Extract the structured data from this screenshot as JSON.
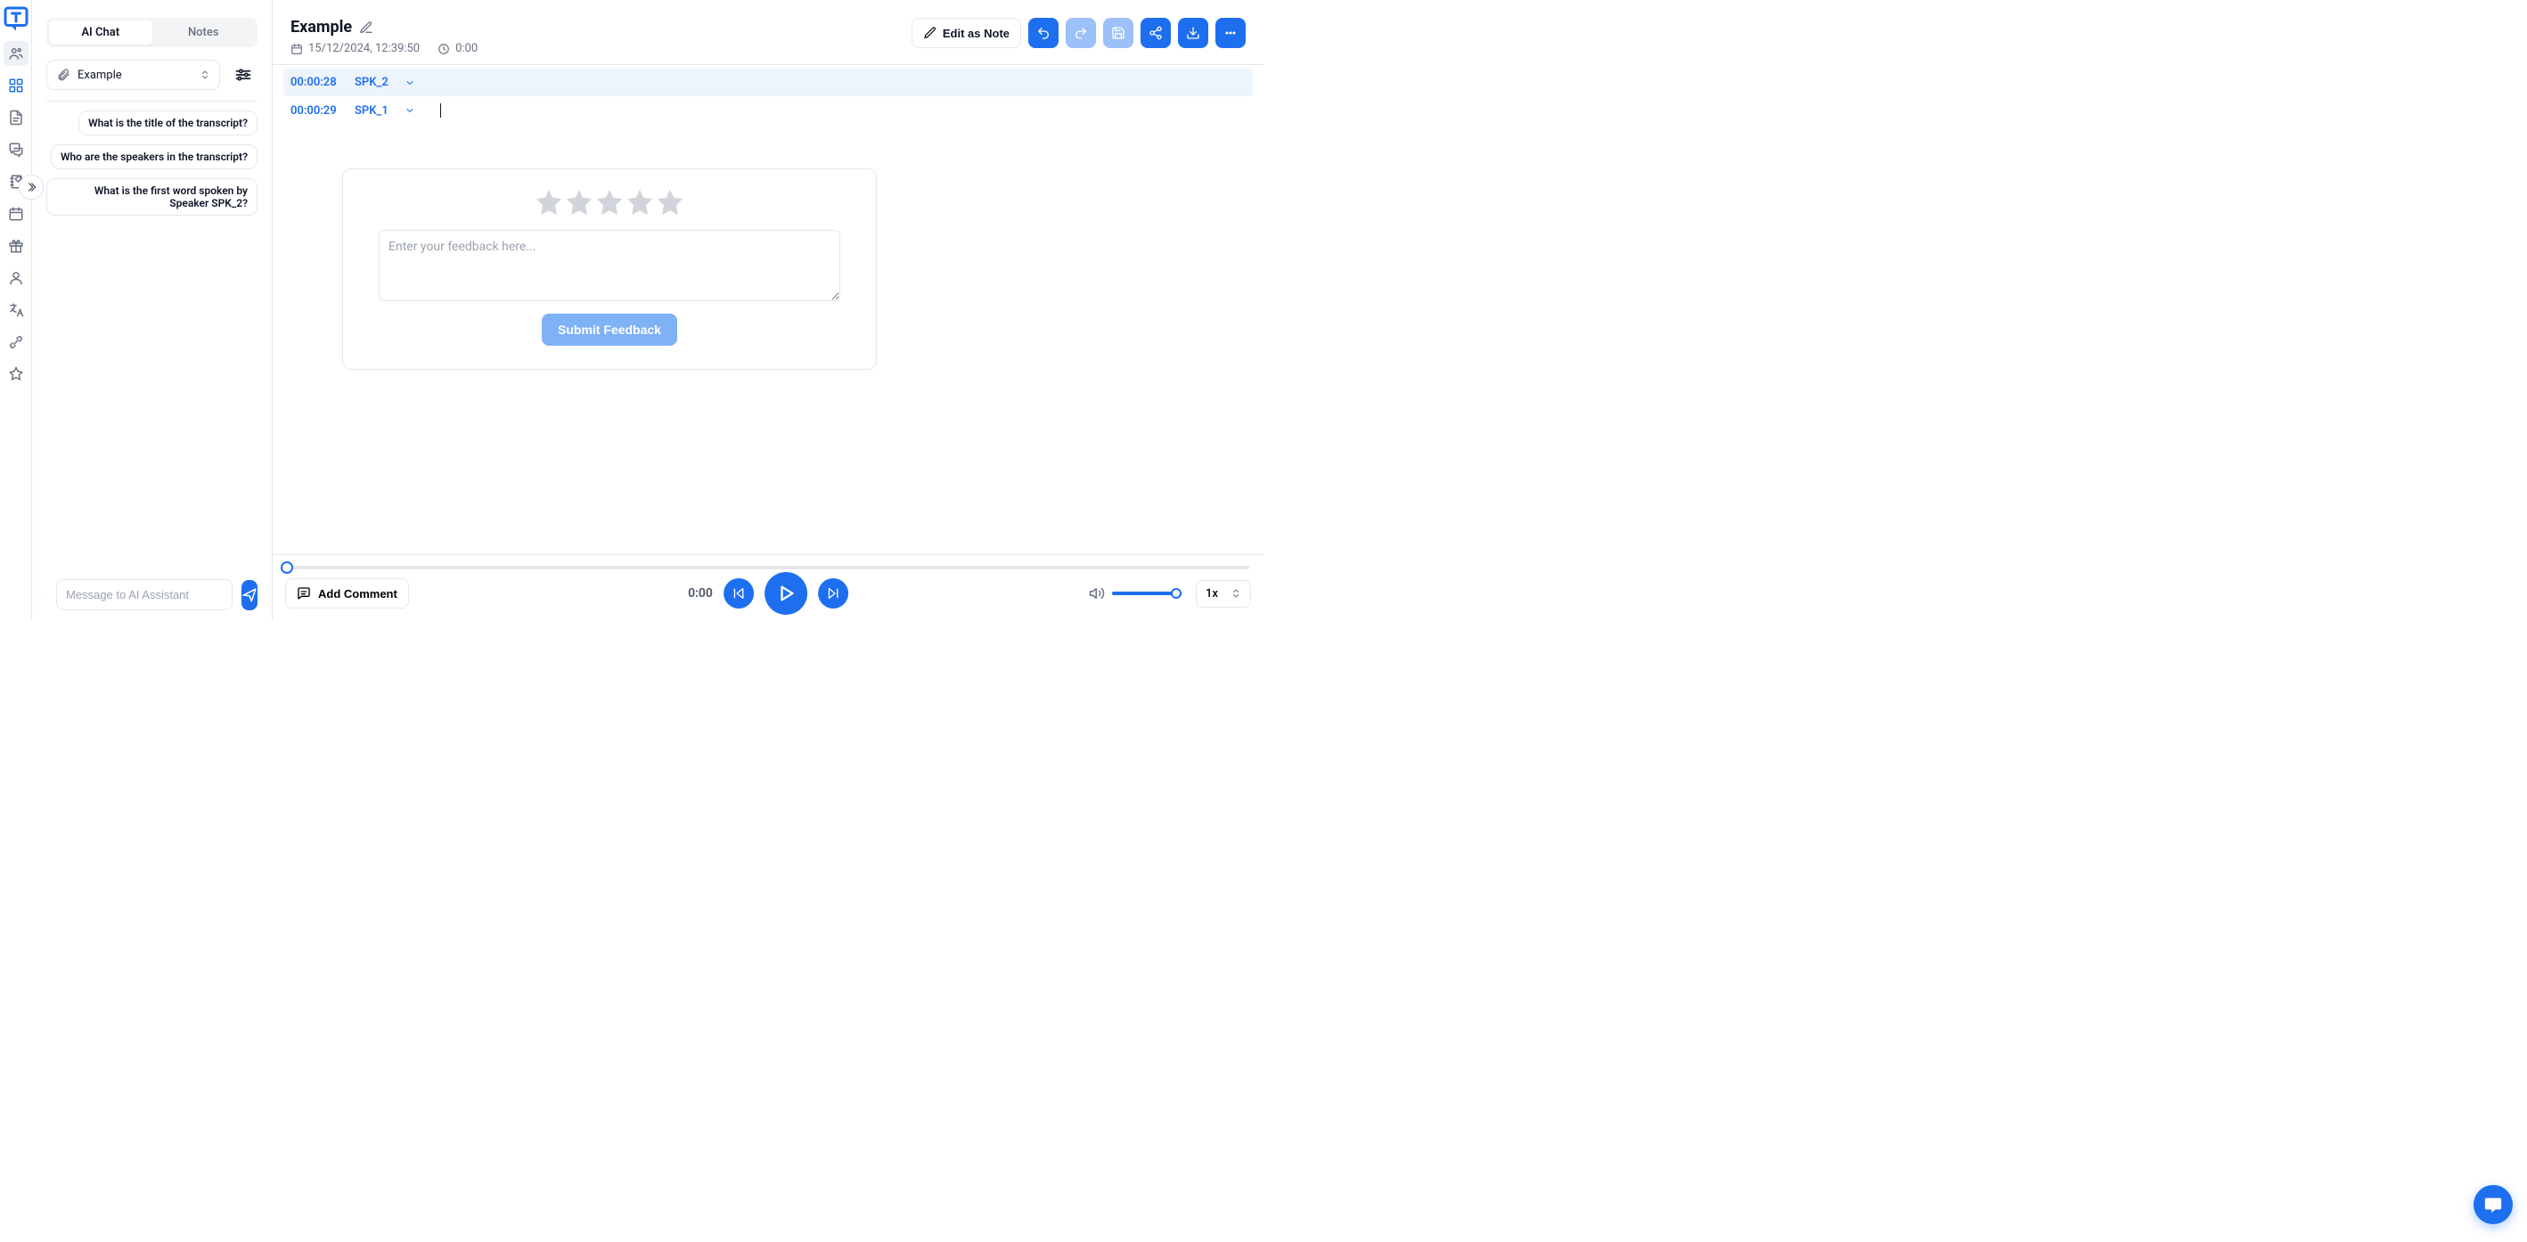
{
  "sidebar": {},
  "left": {
    "tabs": {
      "ai_chat": "AI Chat",
      "notes": "Notes"
    },
    "selector_label": "Example",
    "suggestions": [
      "What is the title of the transcript?",
      "Who are the speakers in the transcript?",
      "What is the first word spoken by Speaker SPK_2?"
    ],
    "compose_placeholder": "Message to AI Assistant"
  },
  "header": {
    "title": "Example",
    "date": "15/12/2024, 12:39:50",
    "duration": "0:00",
    "edit_as_note": "Edit as Note"
  },
  "transcript": [
    {
      "time": "00:00:28",
      "speaker": "SPK_2",
      "selected": true
    },
    {
      "time": "00:00:29",
      "speaker": "SPK_1",
      "selected": false
    }
  ],
  "feedback": {
    "placeholder": "Enter your feedback here...",
    "submit_label": "Submit Feedback"
  },
  "player": {
    "add_comment": "Add Comment",
    "current_time": "0:00",
    "speed": "1x"
  }
}
